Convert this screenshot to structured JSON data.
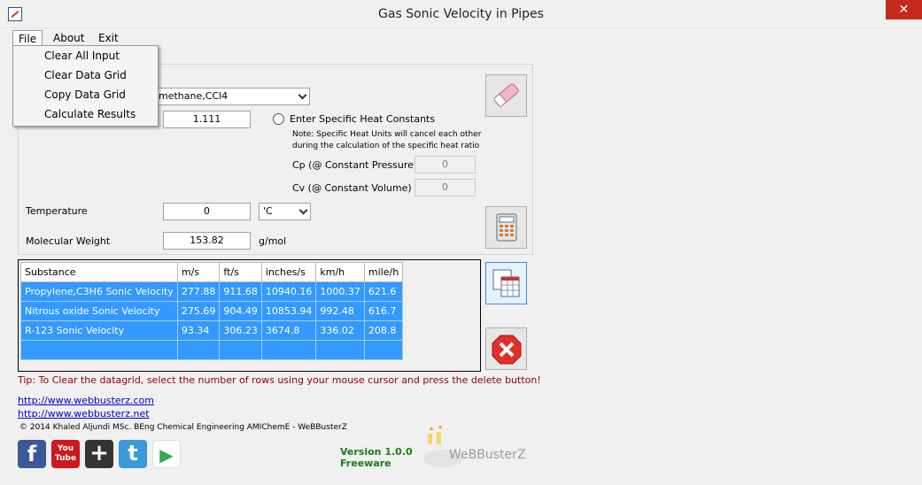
{
  "window": {
    "title": "Gas Sonic Velocity in Pipes",
    "close_glyph": "✕"
  },
  "menu": {
    "items": [
      "File",
      "About",
      "Exit"
    ],
    "file_dropdown": [
      "Clear All Input",
      "Clear Data Grid",
      "Copy Data Grid",
      "Calculate Results"
    ]
  },
  "form": {
    "substance_value": "methane,CCl4",
    "ratio_value": "1.111",
    "specific_heat_radio_label": "Enter Specific Heat Constants",
    "note": "Note: Specific Heat Units will cancel each other during the calculation of the specific heat ratio",
    "cp_label": "Cp (@ Constant Pressure)",
    "cp_value": "0",
    "cv_label": "Cv (@ Constant Volume)",
    "cv_value": "0",
    "temperature_label": "Temperature",
    "temperature_value": "0",
    "temperature_unit": "'C",
    "mw_label": "Molecular Weight",
    "mw_value": "153.82",
    "mw_unit": "g/mol"
  },
  "grid": {
    "headers": [
      "Substance",
      "m/s",
      "ft/s",
      "inches/s",
      "km/h",
      "mile/h"
    ],
    "rows": [
      [
        "Propylene,C3H6 Sonic Velocity",
        "277.88",
        "911.68",
        "10940.16",
        "1000.37",
        "621.6"
      ],
      [
        "Nitrous oxide Sonic Velocity",
        "275.69",
        "904.49",
        "10853.94",
        "992.48",
        "616.7"
      ],
      [
        "R-123 Sonic Velocity",
        "93.34",
        "306.23",
        "3674.8",
        "336.02",
        "208.8"
      ],
      [
        "",
        "",
        "",
        "",
        "",
        ""
      ]
    ]
  },
  "tip": "Tip: To Clear the datagrid, select the number of rows using your mouse cursor and press the delete button!",
  "links": [
    "http://www.webbusterz.com",
    "http://www.webbusterz.net"
  ],
  "copyright": "© 2014 Khaled Aljundi MSc. BEng Chemical Engineering AMIChemE - WeBBusterZ",
  "social": [
    {
      "icon": "facebook-icon",
      "glyph": "f",
      "color": "#3b5998"
    },
    {
      "icon": "youtube-icon",
      "glyph": "You Tube",
      "color": "#cc181e"
    },
    {
      "icon": "google-plus-icon",
      "glyph": "+",
      "color": "#333333"
    },
    {
      "icon": "twitter-icon",
      "glyph": "t",
      "color": "#3a9ad9"
    },
    {
      "icon": "play-store-icon",
      "glyph": "▶",
      "color": "#ffffff"
    }
  ],
  "version": {
    "line1": "Version 1.0.0",
    "line2": "Freeware"
  },
  "brand": "WeBBusterZ"
}
